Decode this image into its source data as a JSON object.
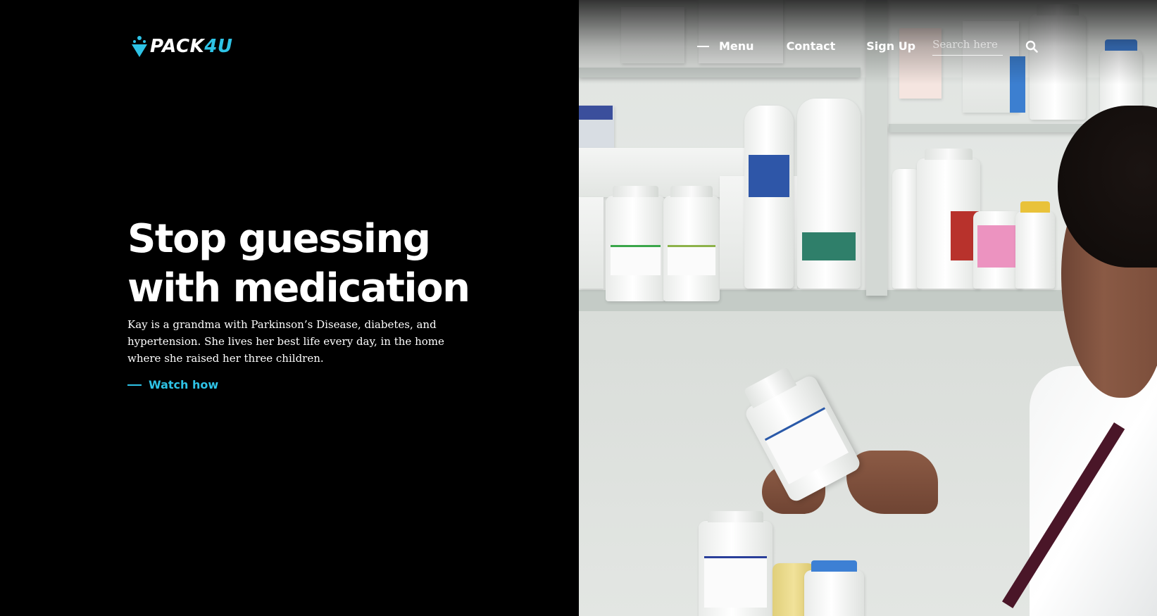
{
  "brand": {
    "logo_text_main": "PACK",
    "logo_text_accent": "4U",
    "accent_color": "#2ec3e6"
  },
  "nav": {
    "menu_label": "Menu",
    "contact_label": "Contact",
    "signup_label": "Sign Up",
    "search_placeholder": "Search here",
    "search_icon": "search-icon"
  },
  "hero": {
    "title_line1": "Stop guessing",
    "title_line2": "with medication",
    "description": "Kay is a grandma with Parkinson’s Disease, diabetes, and hypertension. She lives her best life every day, in the home where she raised her three children.",
    "cta_label": "Watch how"
  },
  "colors": {
    "background": "#000000",
    "text": "#ffffff",
    "accent": "#2ec3e6"
  }
}
